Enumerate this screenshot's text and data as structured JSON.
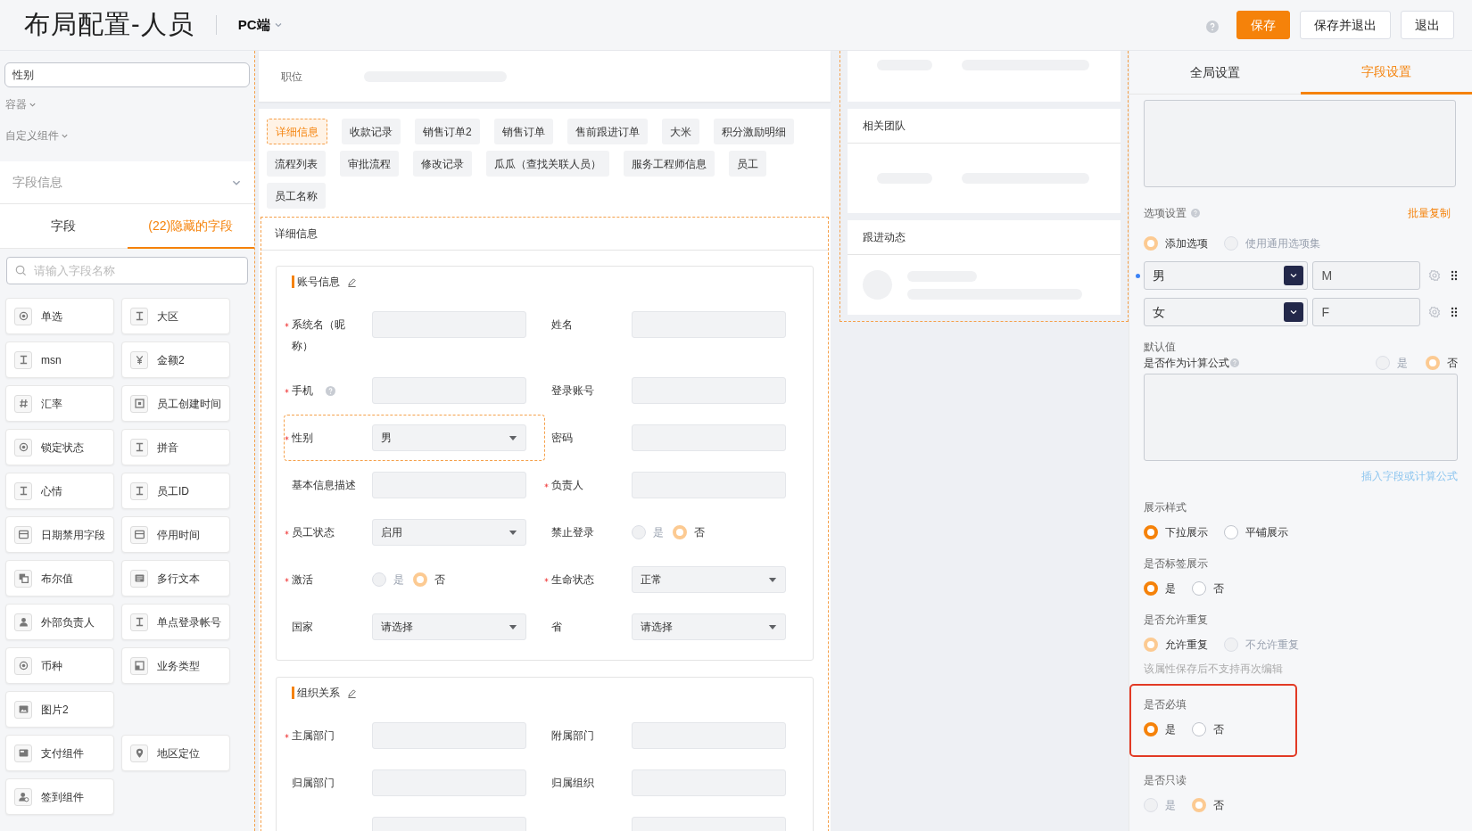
{
  "header": {
    "title": "布局配置-人员",
    "platform": "PC端",
    "buttons": [
      {
        "label": "保存",
        "kind": "primary"
      },
      {
        "label": "保存并退出",
        "kind": "default"
      },
      {
        "label": "退出",
        "kind": "default"
      }
    ]
  },
  "sidebar": {
    "search_value": "性别",
    "groups": [
      "容器",
      "自定义组件"
    ],
    "section_title": "字段信息",
    "tabs": [
      {
        "label": "字段",
        "selected": false
      },
      {
        "label": "(22)隐藏的字段",
        "selected": true
      }
    ],
    "field_search": {
      "placeholder": "请输入字段名称"
    },
    "field_rows": [
      [
        {
          "label": "单选",
          "kind": "radio"
        },
        {
          "label": "大区",
          "kind": "text"
        }
      ],
      [
        {
          "label": "msn",
          "kind": "text"
        },
        {
          "label": "金额2",
          "kind": "currency"
        }
      ],
      [
        {
          "label": "汇率",
          "kind": "number"
        },
        {
          "label": "员工创建时间",
          "kind": "datetime"
        }
      ],
      [
        {
          "label": "锁定状态",
          "kind": "radio"
        },
        {
          "label": "拼音",
          "kind": "text"
        }
      ],
      [
        {
          "label": "心情",
          "kind": "text"
        },
        {
          "label": "员工ID",
          "kind": "text"
        }
      ],
      [
        {
          "label": "日期禁用字段",
          "kind": "date"
        },
        {
          "label": "停用时间",
          "kind": "date"
        }
      ],
      [
        {
          "label": "布尔值",
          "kind": "boolean"
        },
        {
          "label": "多行文本",
          "kind": "textarea"
        }
      ],
      [
        {
          "label": "外部负责人",
          "kind": "person"
        },
        {
          "label": "单点登录帐号",
          "kind": "text"
        }
      ],
      [
        {
          "label": "币种",
          "kind": "radio"
        },
        {
          "label": "业务类型",
          "kind": "type"
        }
      ],
      [
        {
          "label": "图片2",
          "kind": "image"
        }
      ],
      [
        {
          "label": "支付组件",
          "kind": "payment"
        },
        {
          "label": "地区定位",
          "kind": "location"
        }
      ],
      [
        {
          "label": "签到组件",
          "kind": "signin"
        }
      ]
    ]
  },
  "preview": {
    "top_card": {
      "label": "职位"
    },
    "tabs": [
      {
        "label": "详细信息",
        "selected": true
      },
      {
        "label": "收款记录",
        "selected": false
      },
      {
        "label": "销售订单2",
        "selected": false
      },
      {
        "label": "销售订单",
        "selected": false
      },
      {
        "label": "售前跟进订单",
        "selected": false
      },
      {
        "label": "大米",
        "selected": false
      },
      {
        "label": "积分激励明细",
        "selected": false
      },
      {
        "label": "流程列表",
        "selected": false
      },
      {
        "label": "审批流程",
        "selected": false
      },
      {
        "label": "修改记录",
        "selected": false
      },
      {
        "label": "瓜瓜（查找关联人员）",
        "selected": false
      },
      {
        "label": "服务工程师信息",
        "selected": false
      },
      {
        "label": "员工",
        "selected": false
      },
      {
        "label": "员工名称",
        "selected": false
      }
    ],
    "detail": {
      "title": "详细信息",
      "sections": [
        {
          "title": "账号信息",
          "fields": [
            {
              "label": "系统名（昵称）",
              "kind": "input",
              "required": true,
              "selected": false
            },
            {
              "label": "姓名",
              "kind": "input",
              "required": false,
              "selected": false
            },
            {
              "label": "手机",
              "kind": "input",
              "required": true,
              "help": true,
              "selected": false
            },
            {
              "label": "登录账号",
              "kind": "input",
              "required": false,
              "selected": false
            },
            {
              "label": "性别",
              "kind": "select",
              "value": "男",
              "required": true,
              "selected": true
            },
            {
              "label": "密码",
              "kind": "input",
              "required": false,
              "selected": false
            },
            {
              "label": "基本信息描述",
              "kind": "input",
              "required": false,
              "selected": false
            },
            {
              "label": "负责人",
              "kind": "input",
              "required": true,
              "selected": false
            },
            {
              "label": "员工状态",
              "kind": "select",
              "value": "启用",
              "required": true,
              "selected": false
            },
            {
              "label": "禁止登录",
              "kind": "radio",
              "required": false,
              "selected": false,
              "options": [
                {
                  "label": "是",
                  "selected": false
                },
                {
                  "label": "否",
                  "selected": true
                }
              ]
            },
            {
              "label": "激活",
              "kind": "radio",
              "required": true,
              "selected": false,
              "options": [
                {
                  "label": "是",
                  "selected": false
                },
                {
                  "label": "否",
                  "selected": true
                }
              ]
            },
            {
              "label": "生命状态",
              "kind": "select",
              "value": "正常",
              "required": true,
              "selected": false
            },
            {
              "label": "国家",
              "kind": "select",
              "value": "请选择",
              "required": false,
              "selected": false
            },
            {
              "label": "省",
              "kind": "select",
              "value": "请选择",
              "required": false,
              "selected": false
            }
          ]
        },
        {
          "title": "组织关系",
          "fields": [
            {
              "label": "主属部门",
              "kind": "input",
              "required": true,
              "selected": false
            },
            {
              "label": "附属部门",
              "kind": "input",
              "required": false,
              "selected": false
            },
            {
              "label": "归属部门",
              "kind": "input",
              "required": false,
              "selected": false
            },
            {
              "label": "归属组织",
              "kind": "input",
              "required": false,
              "selected": false
            },
            {
              "kind": "input",
              "required": false,
              "selected": false
            },
            {
              "kind": "input",
              "required": false,
              "selected": false
            }
          ]
        }
      ]
    }
  },
  "side_cards": [
    {
      "kind": "skeleton"
    },
    {
      "kind": "list",
      "title": "相关团队"
    },
    {
      "kind": "activity",
      "title": "跟进动态"
    }
  ],
  "settings": {
    "tabs": [
      {
        "label": "全局设置",
        "selected": false
      },
      {
        "label": "字段设置",
        "selected": true
      }
    ],
    "option_settings": {
      "label": "选项设置",
      "link": "批量复制",
      "mode_disabled": true,
      "mode": [
        {
          "label": "添加选项",
          "selected": true
        },
        {
          "label": "使用通用选项集",
          "selected": false
        }
      ],
      "options": [
        {
          "label": "男",
          "value": "M",
          "selected": true
        },
        {
          "label": "女",
          "value": "F",
          "selected": false
        }
      ]
    },
    "default_value": {
      "label": "默认值",
      "formula_label": "是否作为计算公式",
      "formula_disabled": true,
      "formula_options": [
        {
          "label": "是",
          "selected": false
        },
        {
          "label": "否",
          "selected": true
        }
      ],
      "link": "插入字段或计算公式"
    },
    "groups": [
      {
        "label": "展示样式",
        "disabled": false,
        "highlighted": false,
        "options": [
          {
            "label": "下拉展示",
            "selected": true
          },
          {
            "label": "平铺展示",
            "selected": false
          }
        ]
      },
      {
        "label": "是否标签展示",
        "disabled": false,
        "highlighted": false,
        "options": [
          {
            "label": "是",
            "selected": true
          },
          {
            "label": "否",
            "selected": false
          }
        ]
      },
      {
        "label": "是否允许重复",
        "disabled": true,
        "highlighted": false,
        "note": "该属性保存后不支持再次编辑",
        "options": [
          {
            "label": "允许重复",
            "selected": true
          },
          {
            "label": "不允许重复",
            "selected": false
          }
        ]
      },
      {
        "label": "是否必填",
        "disabled": false,
        "highlighted": true,
        "options": [
          {
            "label": "是",
            "selected": true
          },
          {
            "label": "否",
            "selected": false
          }
        ]
      },
      {
        "label": "是否只读",
        "disabled": true,
        "highlighted": false,
        "options": [
          {
            "label": "是",
            "selected": false
          },
          {
            "label": "否",
            "selected": true
          }
        ]
      }
    ]
  }
}
